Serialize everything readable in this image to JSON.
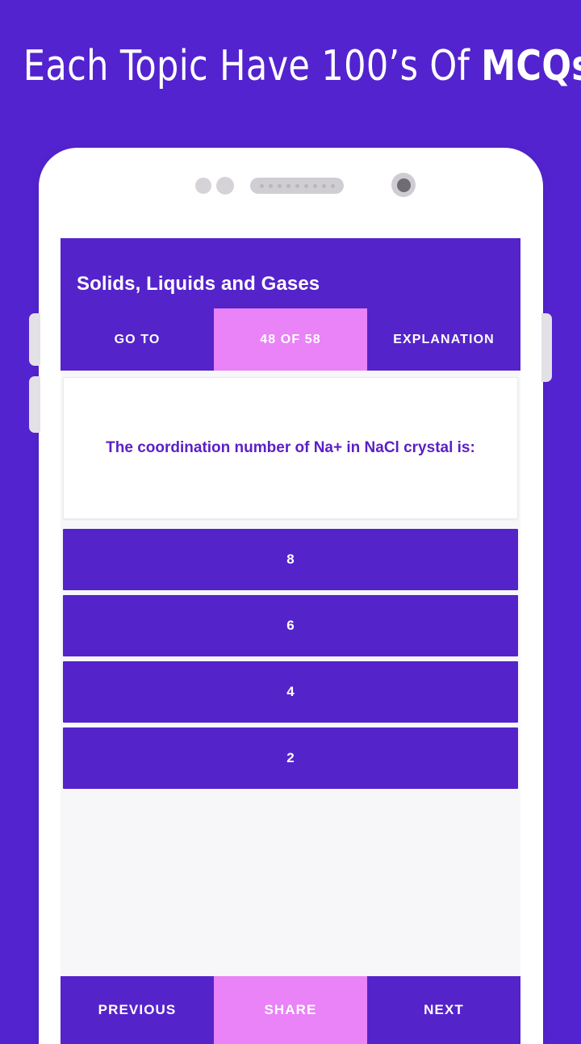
{
  "promo": {
    "headline_normal": "Each Topic Have 100’s Of ",
    "headline_strong": "MCQs"
  },
  "colors": {
    "background": "#5323cf",
    "primary": "#5523ca",
    "accent_pink": "#e983f7",
    "question_text": "#5b1fc4",
    "screen_background": "#f7f7f9",
    "card_background": "#ffffff"
  },
  "app": {
    "title": "Solids, Liquids and Gases",
    "tabs": [
      {
        "label": "GO TO",
        "active": false
      },
      {
        "label": "48 OF 58",
        "active": true
      },
      {
        "label": "EXPLANATION",
        "active": false
      }
    ],
    "question": "The coordination number of Na+ in NaCl crystal is:",
    "options": [
      {
        "label": "8"
      },
      {
        "label": "6"
      },
      {
        "label": "4"
      },
      {
        "label": "2"
      }
    ],
    "bottom_bar": [
      {
        "label": "PREVIOUS",
        "accent": false
      },
      {
        "label": "SHARE",
        "accent": true
      },
      {
        "label": "NEXT",
        "accent": false
      }
    ]
  },
  "device": {
    "speaker_dots": 9
  }
}
